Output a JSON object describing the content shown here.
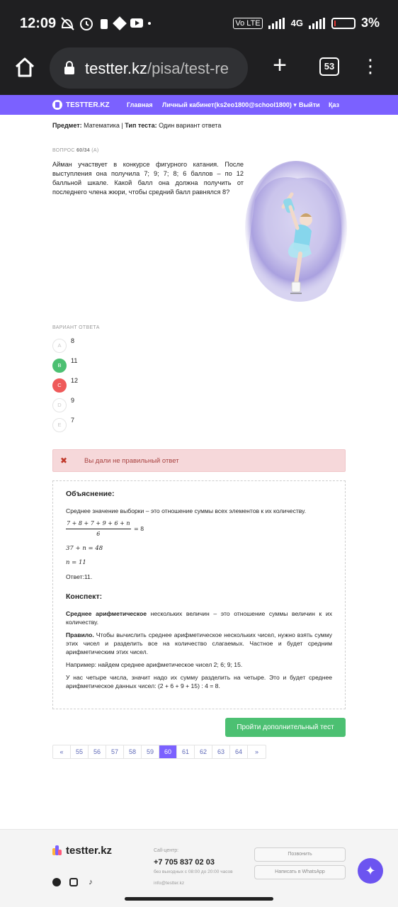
{
  "status": {
    "time": "12:09",
    "battery": "3%",
    "network": "4G",
    "volte": "Vo LTE"
  },
  "browser": {
    "url_domain": "testter.kz",
    "url_path": "/pisa/test-re",
    "tab_count": "53"
  },
  "nav": {
    "logo": "TESTTER.KZ",
    "links": [
      "Главная",
      "Личный кабинет(ks2eo1800@school1800)",
      "Выйти",
      "Қаз"
    ]
  },
  "meta": {
    "subject_label": "Предмет:",
    "subject": "Математика",
    "separator": "|",
    "type_label": "Тип теста:",
    "type": "Один вариант ответа"
  },
  "question": {
    "number_label": "ВОПРОС",
    "number": "60/34",
    "suffix": "(А)",
    "text": "Айман участвует в конкурсе фигурного катания. После выступления она получила 7; 9; 7; 8; 6 баллов – по 12 балльной шкале. Какой балл она должна получить от последнего члена жюри, чтобы средний балл равнялся 8?"
  },
  "answers": {
    "label": "ВАРИАНТ ОТВЕТА",
    "options": [
      {
        "letter": "A",
        "text": "8",
        "state": "none"
      },
      {
        "letter": "B",
        "text": "11",
        "state": "correct"
      },
      {
        "letter": "C",
        "text": "12",
        "state": "wrong"
      },
      {
        "letter": "D",
        "text": "9",
        "state": "none"
      },
      {
        "letter": "E",
        "text": "7",
        "state": "none"
      }
    ]
  },
  "alert": {
    "icon": "✖",
    "text": "Вы дали не правильный ответ"
  },
  "explanation": {
    "title": "Объяснение:",
    "p1": "Среднее значение выборки – это отношение суммы всех элементов к их количеству.",
    "frac_num": "7 + 8 + 7 + 9 + 6 + n",
    "frac_den": "6",
    "frac_tail": "= 8",
    "eq2": "37 + n = 48",
    "eq3": "n = 11",
    "answer": "Ответ:11.",
    "title2": "Конспект:",
    "c1_bold": "Среднее арифметическое",
    "c1_rest": " нескольких величин – это отношение суммы величин к их количеству.",
    "c2_bold": "Правило.",
    "c2_rest": " Чтобы вычислить среднее арифметическое нескольких чисел, нужно взять сумму этих чисел и разделить все на количество слагаемых. Частное и будет средним арифметическим этих чисел.",
    "c3": "Например: найдем среднее арифметическое чисел 2; 6; 9; 15.",
    "c4": "У нас четыре числа, значит надо их сумму разделить на четыре. Это и будет среднее арифметическое данных чисел: (2 + 6 + 9 + 15) : 4 = 8."
  },
  "more_button": "Пройти дополнительный тест",
  "pagination": {
    "prev": "«",
    "pages": [
      "55",
      "56",
      "57",
      "58",
      "59",
      "60",
      "61",
      "62",
      "63",
      "64"
    ],
    "active": "60",
    "next": "»"
  },
  "footer": {
    "logo": "testter.kz",
    "call_label": "Call-центр:",
    "phone": "+7 705 837 02 03",
    "hours": "без выходных с 08:00 до 20:00 часов",
    "email": "info@testter.kz",
    "btn_call": "Позвонить",
    "btn_whatsapp": "Написать в WhatsApp"
  },
  "colors": {
    "accent": "#7b61ff",
    "correct": "#4cc072",
    "wrong": "#ef5a5a"
  }
}
